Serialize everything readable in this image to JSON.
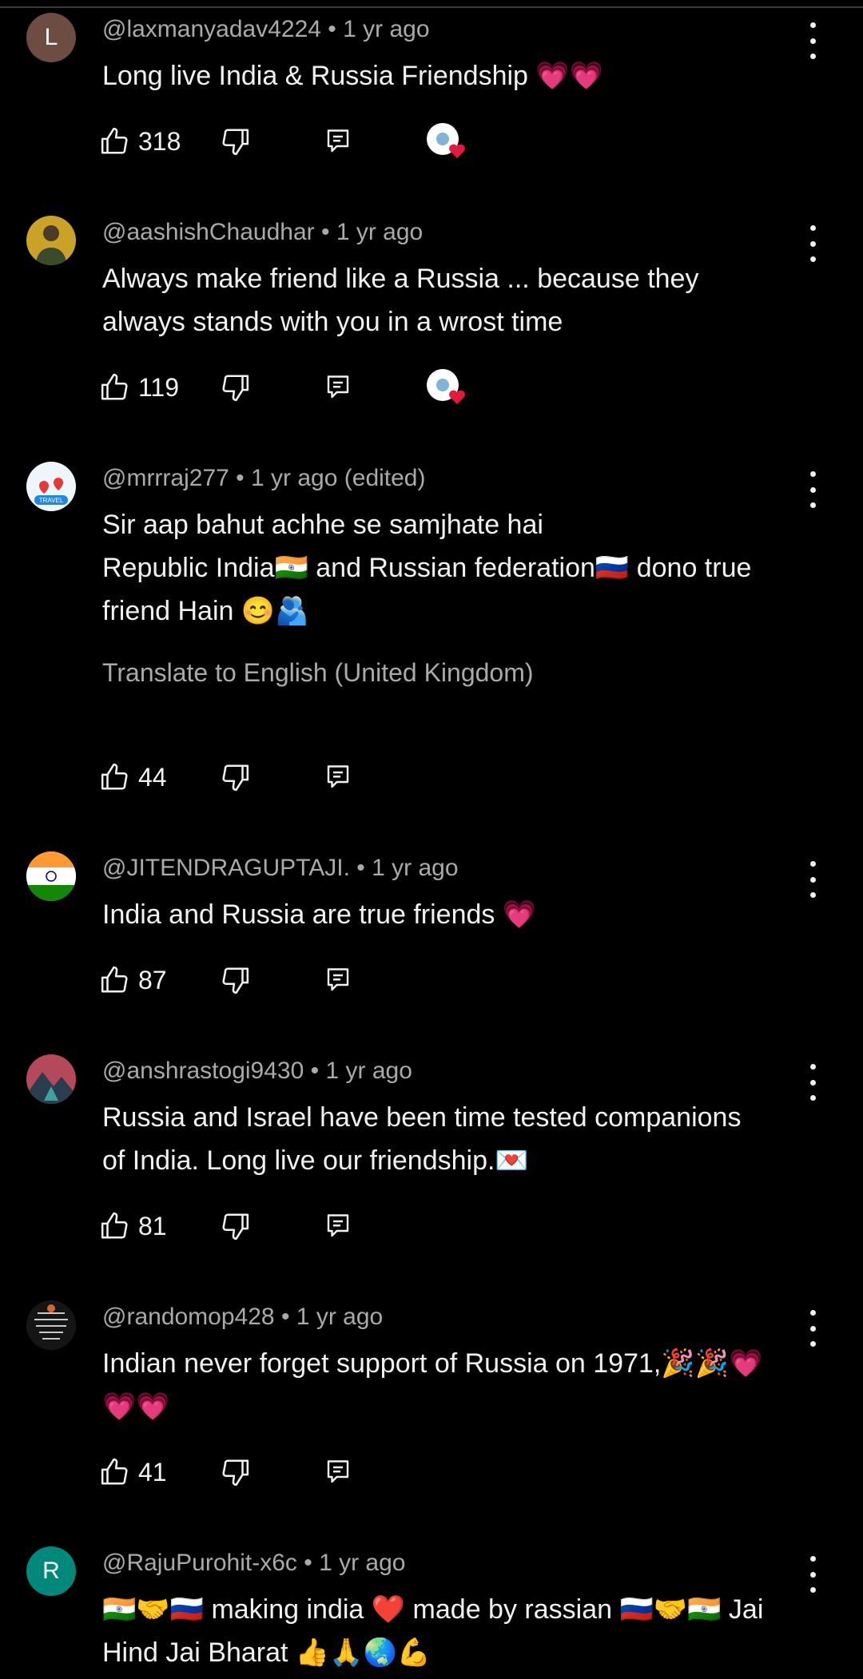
{
  "comments": [
    {
      "avatar_letter": "L",
      "avatar_color": "#6d4c41",
      "author": "@laxmanyadav4224",
      "time": "1 yr ago",
      "edited": "",
      "lines": [
        "Long live India & Russia Friendship 💗💗"
      ],
      "translate": "",
      "likes": "318",
      "creator_heart": true
    },
    {
      "avatar_letter": "",
      "avatar_color": "#c9a227",
      "author": "@aashishChaudhar",
      "time": "1 yr ago",
      "edited": "",
      "lines": [
        "Always make friend like a Russia ... because they",
        "always stands with you in a wrost time"
      ],
      "translate": "",
      "likes": "119",
      "creator_heart": true
    },
    {
      "avatar_letter": "TRAVEL",
      "avatar_color": "#eef6fb",
      "author": "@mrrraj277",
      "time": "1 yr ago",
      "edited": "(edited)",
      "lines": [
        "Sir aap bahut achhe se samjhate hai",
        "Republic India🇮🇳 and Russian federation🇷🇺 dono true",
        "friend Hain 😊🫂"
      ],
      "translate": "Translate to English (United Kingdom)",
      "likes": "44",
      "creator_heart": false
    },
    {
      "avatar_letter": "",
      "avatar_color": "#ffffff",
      "author": "@JITENDRAGUPTAJI.",
      "time": "1 yr ago",
      "edited": "",
      "lines": [
        "India and Russia are true friends 💗"
      ],
      "translate": "",
      "likes": "87",
      "creator_heart": false
    },
    {
      "avatar_letter": "",
      "avatar_color": "#8a3b4a",
      "author": "@anshrastogi9430",
      "time": "1 yr ago",
      "edited": "",
      "lines": [
        "Russia and Israel have been time tested companions",
        "of India. Long live our friendship.💌"
      ],
      "translate": "",
      "likes": "81",
      "creator_heart": false
    },
    {
      "avatar_letter": "",
      "avatar_color": "#1a1a1a",
      "author": "@randomop428",
      "time": "1 yr ago",
      "edited": "",
      "lines": [
        "Indian never forget support of Russia on 1971,🎉🎉💗",
        "💗💗"
      ],
      "translate": "",
      "likes": "41",
      "creator_heart": false
    },
    {
      "avatar_letter": "R",
      "avatar_color": "#00897b",
      "author": "@RajuPurohit-x6c",
      "time": "1 yr ago",
      "edited": "",
      "lines": [
        "🇮🇳🤝🇷🇺 making india ❤️ made by rassian 🇷🇺🤝🇮🇳 Jai",
        "Hind Jai Bharat 👍🙏🌏💪"
      ],
      "translate": "",
      "likes": "",
      "creator_heart": false
    }
  ],
  "icons": {
    "like": "thumb-up-icon",
    "dislike": "thumb-down-icon",
    "reply": "reply-icon",
    "more": "more-vert-icon",
    "heart": "creator-heart-icon"
  },
  "colors": {
    "background": "#000000",
    "text": "#f1f1f1",
    "meta": "#aaaaaa",
    "heart": "#e5193b"
  }
}
